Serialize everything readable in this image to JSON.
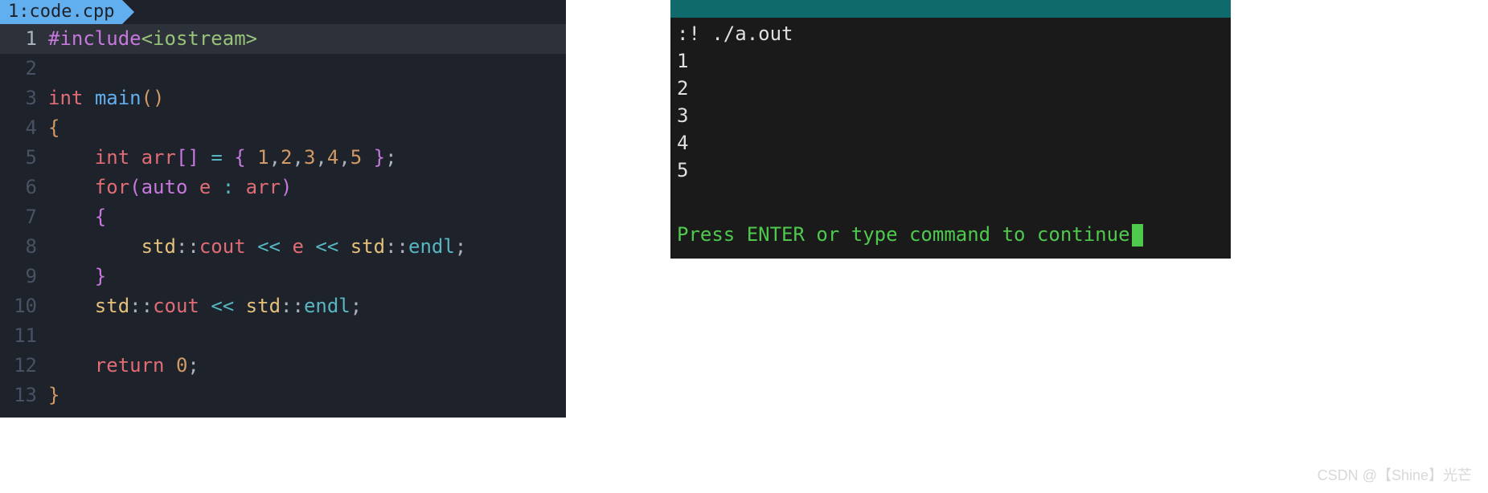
{
  "editor": {
    "tab": {
      "index": "1:",
      "filename": "code.cpp"
    },
    "lines": [
      {
        "num": "1",
        "highlighted": true,
        "tokens": [
          {
            "cls": "tok-preproc",
            "text": "#include"
          },
          {
            "cls": "tok-include",
            "text": "<iostream>"
          }
        ]
      },
      {
        "num": "2",
        "highlighted": false,
        "tokens": []
      },
      {
        "num": "3",
        "highlighted": false,
        "tokens": [
          {
            "cls": "tok-type",
            "text": "int"
          },
          {
            "cls": "tok-punct",
            "text": " "
          },
          {
            "cls": "tok-func",
            "text": "main"
          },
          {
            "cls": "tok-brace",
            "text": "()"
          }
        ]
      },
      {
        "num": "4",
        "highlighted": false,
        "tokens": [
          {
            "cls": "tok-brace",
            "text": "{"
          }
        ]
      },
      {
        "num": "5",
        "highlighted": false,
        "tokens": [
          {
            "cls": "tok-punct",
            "text": "    "
          },
          {
            "cls": "tok-type",
            "text": "int"
          },
          {
            "cls": "tok-punct",
            "text": " "
          },
          {
            "cls": "tok-var",
            "text": "arr"
          },
          {
            "cls": "tok-brace2",
            "text": "[]"
          },
          {
            "cls": "tok-punct",
            "text": " "
          },
          {
            "cls": "tok-op",
            "text": "="
          },
          {
            "cls": "tok-punct",
            "text": " "
          },
          {
            "cls": "tok-brace2",
            "text": "{"
          },
          {
            "cls": "tok-punct",
            "text": " "
          },
          {
            "cls": "tok-number",
            "text": "1"
          },
          {
            "cls": "tok-punct",
            "text": ","
          },
          {
            "cls": "tok-number",
            "text": "2"
          },
          {
            "cls": "tok-punct",
            "text": ","
          },
          {
            "cls": "tok-number",
            "text": "3"
          },
          {
            "cls": "tok-punct",
            "text": ","
          },
          {
            "cls": "tok-number",
            "text": "4"
          },
          {
            "cls": "tok-punct",
            "text": ","
          },
          {
            "cls": "tok-number",
            "text": "5"
          },
          {
            "cls": "tok-punct",
            "text": " "
          },
          {
            "cls": "tok-brace2",
            "text": "}"
          },
          {
            "cls": "tok-punct",
            "text": ";"
          }
        ]
      },
      {
        "num": "6",
        "highlighted": false,
        "tokens": [
          {
            "cls": "tok-punct",
            "text": "    "
          },
          {
            "cls": "tok-keyword2",
            "text": "for"
          },
          {
            "cls": "tok-brace2",
            "text": "("
          },
          {
            "cls": "tok-keyword",
            "text": "auto"
          },
          {
            "cls": "tok-punct",
            "text": " "
          },
          {
            "cls": "tok-var",
            "text": "e"
          },
          {
            "cls": "tok-punct",
            "text": " "
          },
          {
            "cls": "tok-op",
            "text": ":"
          },
          {
            "cls": "tok-punct",
            "text": " "
          },
          {
            "cls": "tok-var",
            "text": "arr"
          },
          {
            "cls": "tok-brace2",
            "text": ")"
          }
        ]
      },
      {
        "num": "7",
        "highlighted": false,
        "tokens": [
          {
            "cls": "tok-punct",
            "text": "    "
          },
          {
            "cls": "tok-brace2",
            "text": "{"
          }
        ]
      },
      {
        "num": "8",
        "highlighted": false,
        "tokens": [
          {
            "cls": "tok-punct",
            "text": "        "
          },
          {
            "cls": "tok-namespace",
            "text": "std"
          },
          {
            "cls": "tok-punct",
            "text": "::"
          },
          {
            "cls": "tok-var",
            "text": "cout"
          },
          {
            "cls": "tok-punct",
            "text": " "
          },
          {
            "cls": "tok-op",
            "text": "<<"
          },
          {
            "cls": "tok-punct",
            "text": " "
          },
          {
            "cls": "tok-var",
            "text": "e"
          },
          {
            "cls": "tok-punct",
            "text": " "
          },
          {
            "cls": "tok-op",
            "text": "<<"
          },
          {
            "cls": "tok-punct",
            "text": " "
          },
          {
            "cls": "tok-namespace",
            "text": "std"
          },
          {
            "cls": "tok-punct",
            "text": "::"
          },
          {
            "cls": "tok-member",
            "text": "endl"
          },
          {
            "cls": "tok-punct",
            "text": ";"
          }
        ]
      },
      {
        "num": "9",
        "highlighted": false,
        "tokens": [
          {
            "cls": "tok-punct",
            "text": "    "
          },
          {
            "cls": "tok-brace2",
            "text": "}"
          }
        ]
      },
      {
        "num": "10",
        "highlighted": false,
        "tokens": [
          {
            "cls": "tok-punct",
            "text": "    "
          },
          {
            "cls": "tok-namespace",
            "text": "std"
          },
          {
            "cls": "tok-punct",
            "text": "::"
          },
          {
            "cls": "tok-var",
            "text": "cout"
          },
          {
            "cls": "tok-punct",
            "text": " "
          },
          {
            "cls": "tok-op",
            "text": "<<"
          },
          {
            "cls": "tok-punct",
            "text": " "
          },
          {
            "cls": "tok-namespace",
            "text": "std"
          },
          {
            "cls": "tok-punct",
            "text": "::"
          },
          {
            "cls": "tok-member",
            "text": "endl"
          },
          {
            "cls": "tok-punct",
            "text": ";"
          }
        ]
      },
      {
        "num": "11",
        "highlighted": false,
        "tokens": []
      },
      {
        "num": "12",
        "highlighted": false,
        "tokens": [
          {
            "cls": "tok-punct",
            "text": "    "
          },
          {
            "cls": "tok-keyword2",
            "text": "return"
          },
          {
            "cls": "tok-punct",
            "text": " "
          },
          {
            "cls": "tok-number",
            "text": "0"
          },
          {
            "cls": "tok-punct",
            "text": ";"
          }
        ]
      },
      {
        "num": "13",
        "highlighted": false,
        "tokens": [
          {
            "cls": "tok-brace",
            "text": "}"
          }
        ]
      }
    ]
  },
  "terminal": {
    "command": ":! ./a.out",
    "output": [
      "1",
      "2",
      "3",
      "4",
      "5"
    ],
    "prompt": "Press ENTER or type command to continue"
  },
  "watermark": "CSDN @【Shine】光芒"
}
